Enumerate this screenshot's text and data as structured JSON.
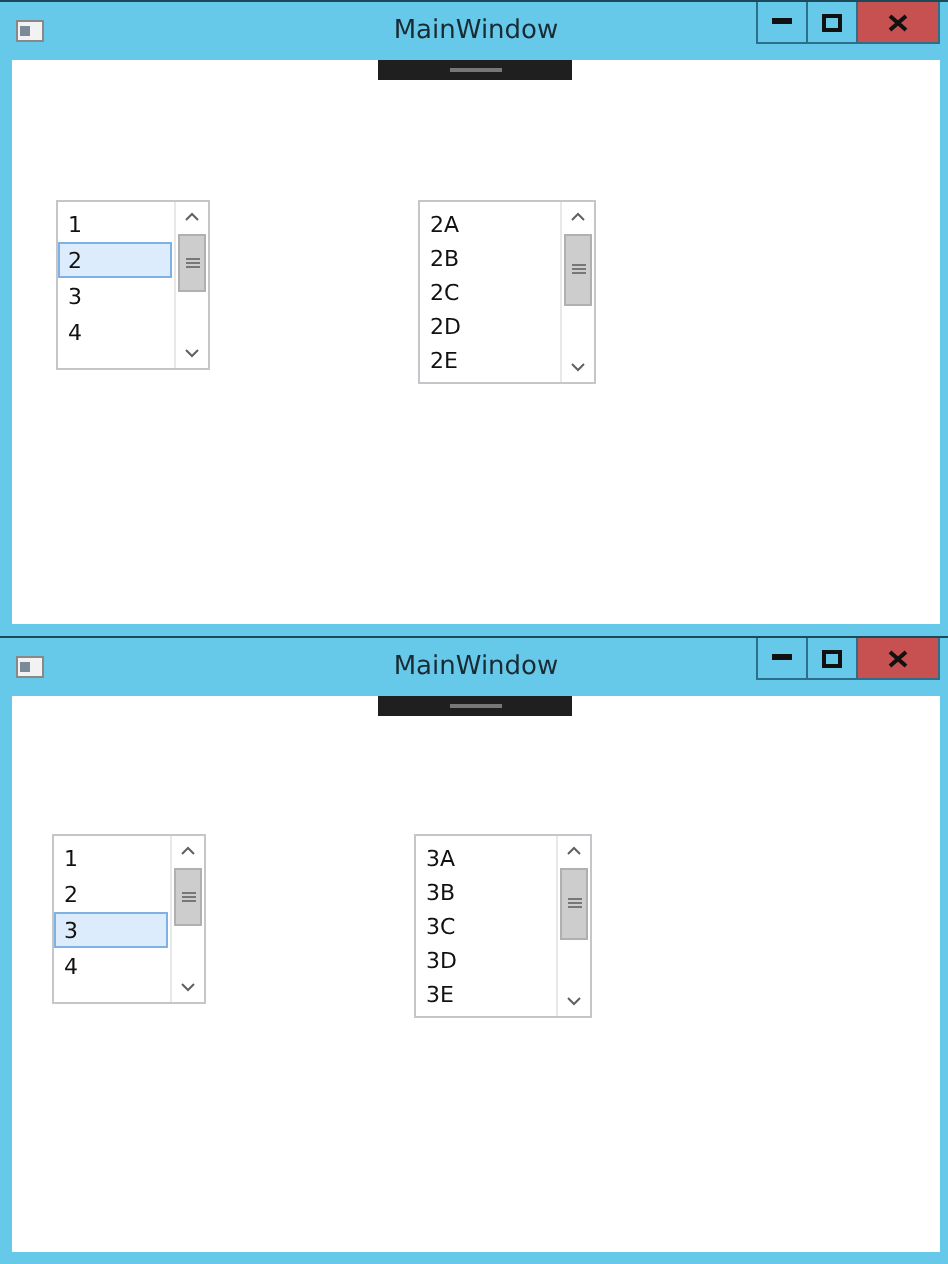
{
  "windows": [
    {
      "title": "MainWindow",
      "lists": [
        {
          "items": [
            {
              "label": "1",
              "selected": false
            },
            {
              "label": "2",
              "selected": true
            },
            {
              "label": "3",
              "selected": false
            },
            {
              "label": "4",
              "selected": false
            }
          ]
        },
        {
          "items": [
            {
              "label": "2A",
              "selected": false
            },
            {
              "label": "2B",
              "selected": false
            },
            {
              "label": "2C",
              "selected": false
            },
            {
              "label": "2D",
              "selected": false
            },
            {
              "label": "2E",
              "selected": false
            }
          ]
        }
      ]
    },
    {
      "title": "MainWindow",
      "lists": [
        {
          "items": [
            {
              "label": "1",
              "selected": false
            },
            {
              "label": "2",
              "selected": false
            },
            {
              "label": "3",
              "selected": true
            },
            {
              "label": "4",
              "selected": false
            }
          ]
        },
        {
          "items": [
            {
              "label": "3A",
              "selected": false
            },
            {
              "label": "3B",
              "selected": false
            },
            {
              "label": "3C",
              "selected": false
            },
            {
              "label": "3D",
              "selected": false
            },
            {
              "label": "3E",
              "selected": false
            }
          ]
        }
      ]
    }
  ]
}
